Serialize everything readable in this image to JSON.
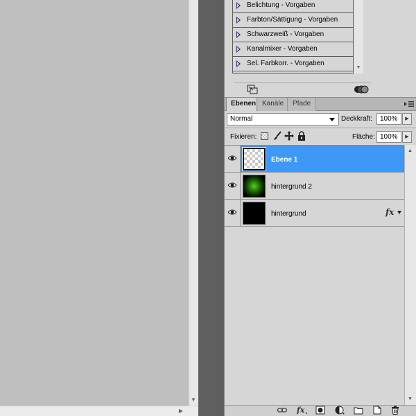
{
  "adjustment_presets": [
    {
      "label": "Belichtung - Vorgaben"
    },
    {
      "label": "Farbton/Sättigung - Vorgaben"
    },
    {
      "label": "Schwarzweiß - Vorgaben"
    },
    {
      "label": "Kanalmixer - Vorgaben"
    },
    {
      "label": "Sel. Farbkorr. - Vorgaben"
    }
  ],
  "tabs": {
    "layers": "Ebenen",
    "channels": "Kanäle",
    "paths": "Pfade"
  },
  "blend_mode": {
    "value": "Normal"
  },
  "opacity": {
    "label": "Deckkraft:",
    "value": "100%"
  },
  "lock": {
    "label": "Fixieren:"
  },
  "fill": {
    "label": "Fläche:",
    "value": "100%"
  },
  "layers": [
    {
      "name": "Ebene 1",
      "selected": true,
      "thumbnail": "transparent"
    },
    {
      "name": "hintergrund 2",
      "selected": false,
      "thumbnail": "green-glow"
    },
    {
      "name": "hintergrund",
      "selected": false,
      "thumbnail": "black",
      "effects": "fx"
    }
  ],
  "colors": {
    "selection": "#3d98f6",
    "panel": "#d6d6d6",
    "canvas": "#bfbfbf",
    "dark_strip": "#5f5f5f"
  }
}
